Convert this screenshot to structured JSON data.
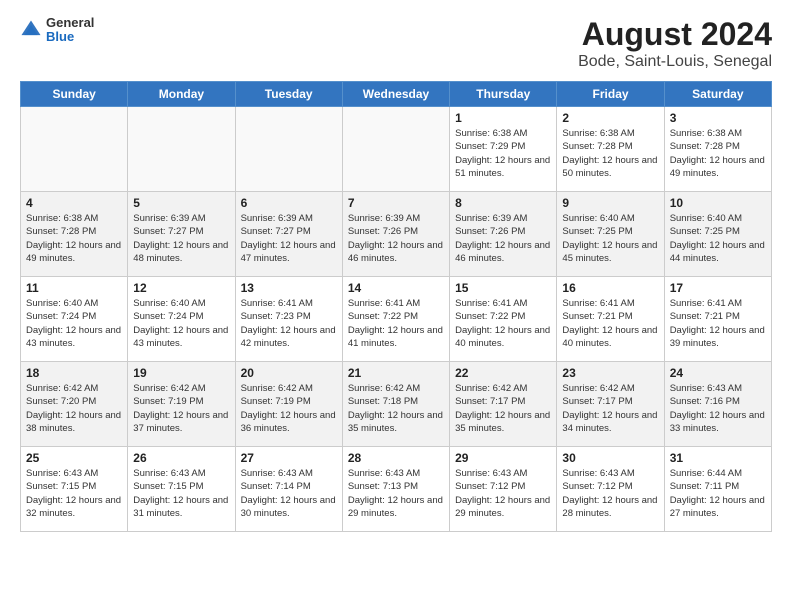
{
  "header": {
    "logo_general": "General",
    "logo_blue": "Blue",
    "title": "August 2024",
    "subtitle": "Bode, Saint-Louis, Senegal"
  },
  "days_of_week": [
    "Sunday",
    "Monday",
    "Tuesday",
    "Wednesday",
    "Thursday",
    "Friday",
    "Saturday"
  ],
  "weeks": [
    [
      {
        "day": "",
        "info": ""
      },
      {
        "day": "",
        "info": ""
      },
      {
        "day": "",
        "info": ""
      },
      {
        "day": "",
        "info": ""
      },
      {
        "day": "1",
        "info": "Sunrise: 6:38 AM\nSunset: 7:29 PM\nDaylight: 12 hours and 51 minutes."
      },
      {
        "day": "2",
        "info": "Sunrise: 6:38 AM\nSunset: 7:28 PM\nDaylight: 12 hours and 50 minutes."
      },
      {
        "day": "3",
        "info": "Sunrise: 6:38 AM\nSunset: 7:28 PM\nDaylight: 12 hours and 49 minutes."
      }
    ],
    [
      {
        "day": "4",
        "info": "Sunrise: 6:38 AM\nSunset: 7:28 PM\nDaylight: 12 hours and 49 minutes."
      },
      {
        "day": "5",
        "info": "Sunrise: 6:39 AM\nSunset: 7:27 PM\nDaylight: 12 hours and 48 minutes."
      },
      {
        "day": "6",
        "info": "Sunrise: 6:39 AM\nSunset: 7:27 PM\nDaylight: 12 hours and 47 minutes."
      },
      {
        "day": "7",
        "info": "Sunrise: 6:39 AM\nSunset: 7:26 PM\nDaylight: 12 hours and 46 minutes."
      },
      {
        "day": "8",
        "info": "Sunrise: 6:39 AM\nSunset: 7:26 PM\nDaylight: 12 hours and 46 minutes."
      },
      {
        "day": "9",
        "info": "Sunrise: 6:40 AM\nSunset: 7:25 PM\nDaylight: 12 hours and 45 minutes."
      },
      {
        "day": "10",
        "info": "Sunrise: 6:40 AM\nSunset: 7:25 PM\nDaylight: 12 hours and 44 minutes."
      }
    ],
    [
      {
        "day": "11",
        "info": "Sunrise: 6:40 AM\nSunset: 7:24 PM\nDaylight: 12 hours and 43 minutes."
      },
      {
        "day": "12",
        "info": "Sunrise: 6:40 AM\nSunset: 7:24 PM\nDaylight: 12 hours and 43 minutes."
      },
      {
        "day": "13",
        "info": "Sunrise: 6:41 AM\nSunset: 7:23 PM\nDaylight: 12 hours and 42 minutes."
      },
      {
        "day": "14",
        "info": "Sunrise: 6:41 AM\nSunset: 7:22 PM\nDaylight: 12 hours and 41 minutes."
      },
      {
        "day": "15",
        "info": "Sunrise: 6:41 AM\nSunset: 7:22 PM\nDaylight: 12 hours and 40 minutes."
      },
      {
        "day": "16",
        "info": "Sunrise: 6:41 AM\nSunset: 7:21 PM\nDaylight: 12 hours and 40 minutes."
      },
      {
        "day": "17",
        "info": "Sunrise: 6:41 AM\nSunset: 7:21 PM\nDaylight: 12 hours and 39 minutes."
      }
    ],
    [
      {
        "day": "18",
        "info": "Sunrise: 6:42 AM\nSunset: 7:20 PM\nDaylight: 12 hours and 38 minutes."
      },
      {
        "day": "19",
        "info": "Sunrise: 6:42 AM\nSunset: 7:19 PM\nDaylight: 12 hours and 37 minutes."
      },
      {
        "day": "20",
        "info": "Sunrise: 6:42 AM\nSunset: 7:19 PM\nDaylight: 12 hours and 36 minutes."
      },
      {
        "day": "21",
        "info": "Sunrise: 6:42 AM\nSunset: 7:18 PM\nDaylight: 12 hours and 35 minutes."
      },
      {
        "day": "22",
        "info": "Sunrise: 6:42 AM\nSunset: 7:17 PM\nDaylight: 12 hours and 35 minutes."
      },
      {
        "day": "23",
        "info": "Sunrise: 6:42 AM\nSunset: 7:17 PM\nDaylight: 12 hours and 34 minutes."
      },
      {
        "day": "24",
        "info": "Sunrise: 6:43 AM\nSunset: 7:16 PM\nDaylight: 12 hours and 33 minutes."
      }
    ],
    [
      {
        "day": "25",
        "info": "Sunrise: 6:43 AM\nSunset: 7:15 PM\nDaylight: 12 hours and 32 minutes."
      },
      {
        "day": "26",
        "info": "Sunrise: 6:43 AM\nSunset: 7:15 PM\nDaylight: 12 hours and 31 minutes."
      },
      {
        "day": "27",
        "info": "Sunrise: 6:43 AM\nSunset: 7:14 PM\nDaylight: 12 hours and 30 minutes."
      },
      {
        "day": "28",
        "info": "Sunrise: 6:43 AM\nSunset: 7:13 PM\nDaylight: 12 hours and 29 minutes."
      },
      {
        "day": "29",
        "info": "Sunrise: 6:43 AM\nSunset: 7:12 PM\nDaylight: 12 hours and 29 minutes."
      },
      {
        "day": "30",
        "info": "Sunrise: 6:43 AM\nSunset: 7:12 PM\nDaylight: 12 hours and 28 minutes."
      },
      {
        "day": "31",
        "info": "Sunrise: 6:44 AM\nSunset: 7:11 PM\nDaylight: 12 hours and 27 minutes."
      }
    ]
  ]
}
